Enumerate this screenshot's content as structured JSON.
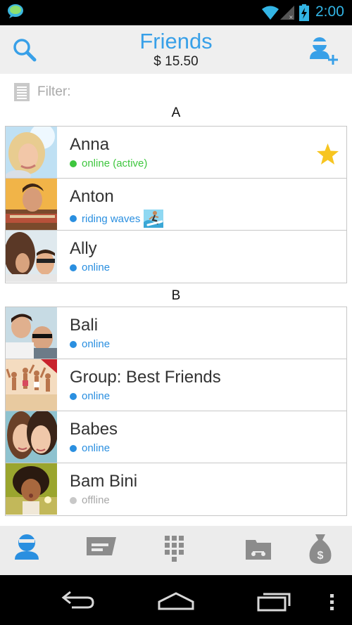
{
  "status_bar": {
    "time": "2:00",
    "icons": [
      "app-notification-icon",
      "wifi-icon",
      "signal-icon",
      "battery-charging-icon"
    ],
    "time_color": "#33b5e5"
  },
  "header": {
    "title": "Friends",
    "balance": "$ 15.50",
    "left_icon": "search-icon",
    "right_icon": "add-user-icon",
    "accent_color": "#38a0e8"
  },
  "filter": {
    "label": "Filter:",
    "icon": "document-list-icon"
  },
  "sections": [
    {
      "letter": "A",
      "contacts": [
        {
          "name": "Anna",
          "status": "online (active)",
          "status_color": "#3ec63e",
          "favorite": true
        },
        {
          "name": "Anton",
          "status": "riding waves",
          "status_color": "#2a8fe0",
          "mood_icon": "surfer-icon"
        },
        {
          "name": "Ally",
          "status": "online",
          "status_color": "#2a8fe0"
        }
      ]
    },
    {
      "letter": "B",
      "contacts": [
        {
          "name": "Bali",
          "status": "online",
          "status_color": "#2a8fe0"
        },
        {
          "name": "Group: Best Friends",
          "status": "online",
          "status_color": "#2a8fe0"
        },
        {
          "name": "Babes",
          "status": "online",
          "status_color": "#2a8fe0"
        },
        {
          "name": "Bam Bini",
          "status": "offline",
          "status_color": "#c8c8c8"
        }
      ]
    }
  ],
  "bottom_nav": {
    "tabs": [
      "contacts-icon",
      "chat-icon",
      "dialpad-icon",
      "voicemail-icon",
      "money-bag-icon"
    ],
    "active_color": "#2a8fe0",
    "inactive_color": "#8c8c8c"
  },
  "system_nav": [
    "back-icon",
    "home-icon",
    "recent-apps-icon",
    "overflow-menu-icon"
  ]
}
